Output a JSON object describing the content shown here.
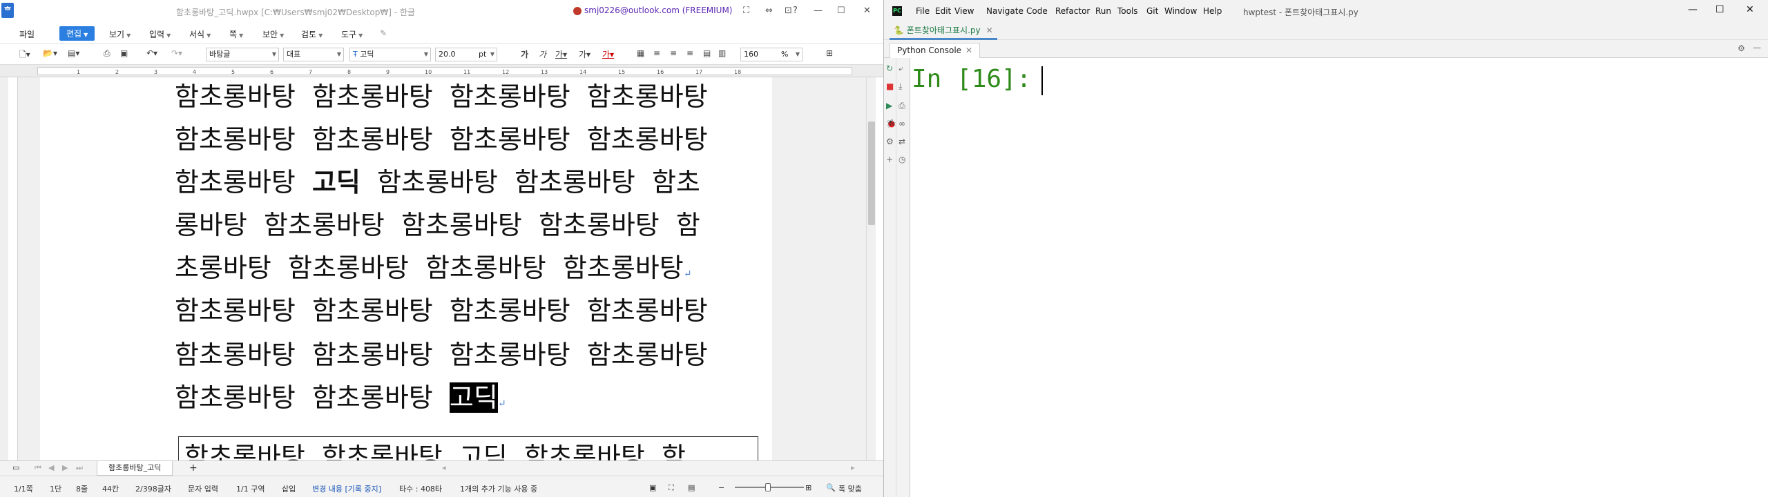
{
  "hwp": {
    "doc_title": "함초롱바탕_고딕.hwpx [C:₩Users₩smj02₩Desktop₩] - 한글",
    "account": "smj0226@outlook.com (FREEMIUM)",
    "menus": [
      "파일",
      "편집",
      "보기",
      "입력",
      "서식",
      "쪽",
      "보안",
      "검토",
      "도구"
    ],
    "toolbar": {
      "style_combo": "바탕글",
      "lang_combo": "대표",
      "font_combo": "고딕",
      "size_value": "20.0",
      "size_unit": "pt",
      "zoom_value": "160",
      "zoom_unit": "%"
    },
    "ruler_numbers": [
      "1",
      "2",
      "3",
      "4",
      "5",
      "6",
      "7",
      "8",
      "9",
      "10",
      "11",
      "12",
      "13",
      "14",
      "15",
      "16",
      "17",
      "18"
    ],
    "lines": [
      "함초롱바탕  함초롱바탕  함초롱바탕  함초롱바탕",
      "함초롱바탕  함초롱바탕  함초롱바탕  함초롱바탕",
      "함초롱바탕  ",
      "고딕",
      "  함초롱바탕  함초롱바탕  함초",
      "롱바탕  함초롱바탕  함초롱바탕  함초롱바탕  함",
      "초롱바탕  함초롱바탕  함초롱바탕  함초롱바탕",
      "함초롱바탕  함초롱바탕  함초롱바탕  함초롱바탕",
      "함초롱바탕  함초롱바탕  함초롱바탕  함초롱바탕",
      "함초롱바탕  함초롱바탕  ",
      "고딕"
    ],
    "boxed_line": "함초롱바탕  함초롱바탕  고딕  함초롱바탕  함",
    "para_mark": "↵",
    "doc_tab": "함초롱바탕_고딕",
    "status": {
      "page": "1/1쪽",
      "section": "1단",
      "line": "8줄",
      "col": "44칸",
      "chars": "2/398글자",
      "mode": "문자 입력",
      "zone": "1/1 구역",
      "insert": "삽입",
      "track": "변경 내용 [기록 중지]",
      "typing": "타수 : 408타",
      "promo": "1개의 추가 기능 사용 중",
      "fit": "폭 맞춤"
    }
  },
  "ide": {
    "menus": [
      "File",
      "Edit",
      "View",
      "Navigate",
      "Code",
      "Refactor",
      "Run",
      "Tools",
      "Git",
      "Window",
      "Help"
    ],
    "project_title": "hwptest - 폰트찾아태그표시.py",
    "file_tab": "폰트찾아태그표시.py",
    "console_tab": "Python Console",
    "prompt": "In [16]: "
  }
}
